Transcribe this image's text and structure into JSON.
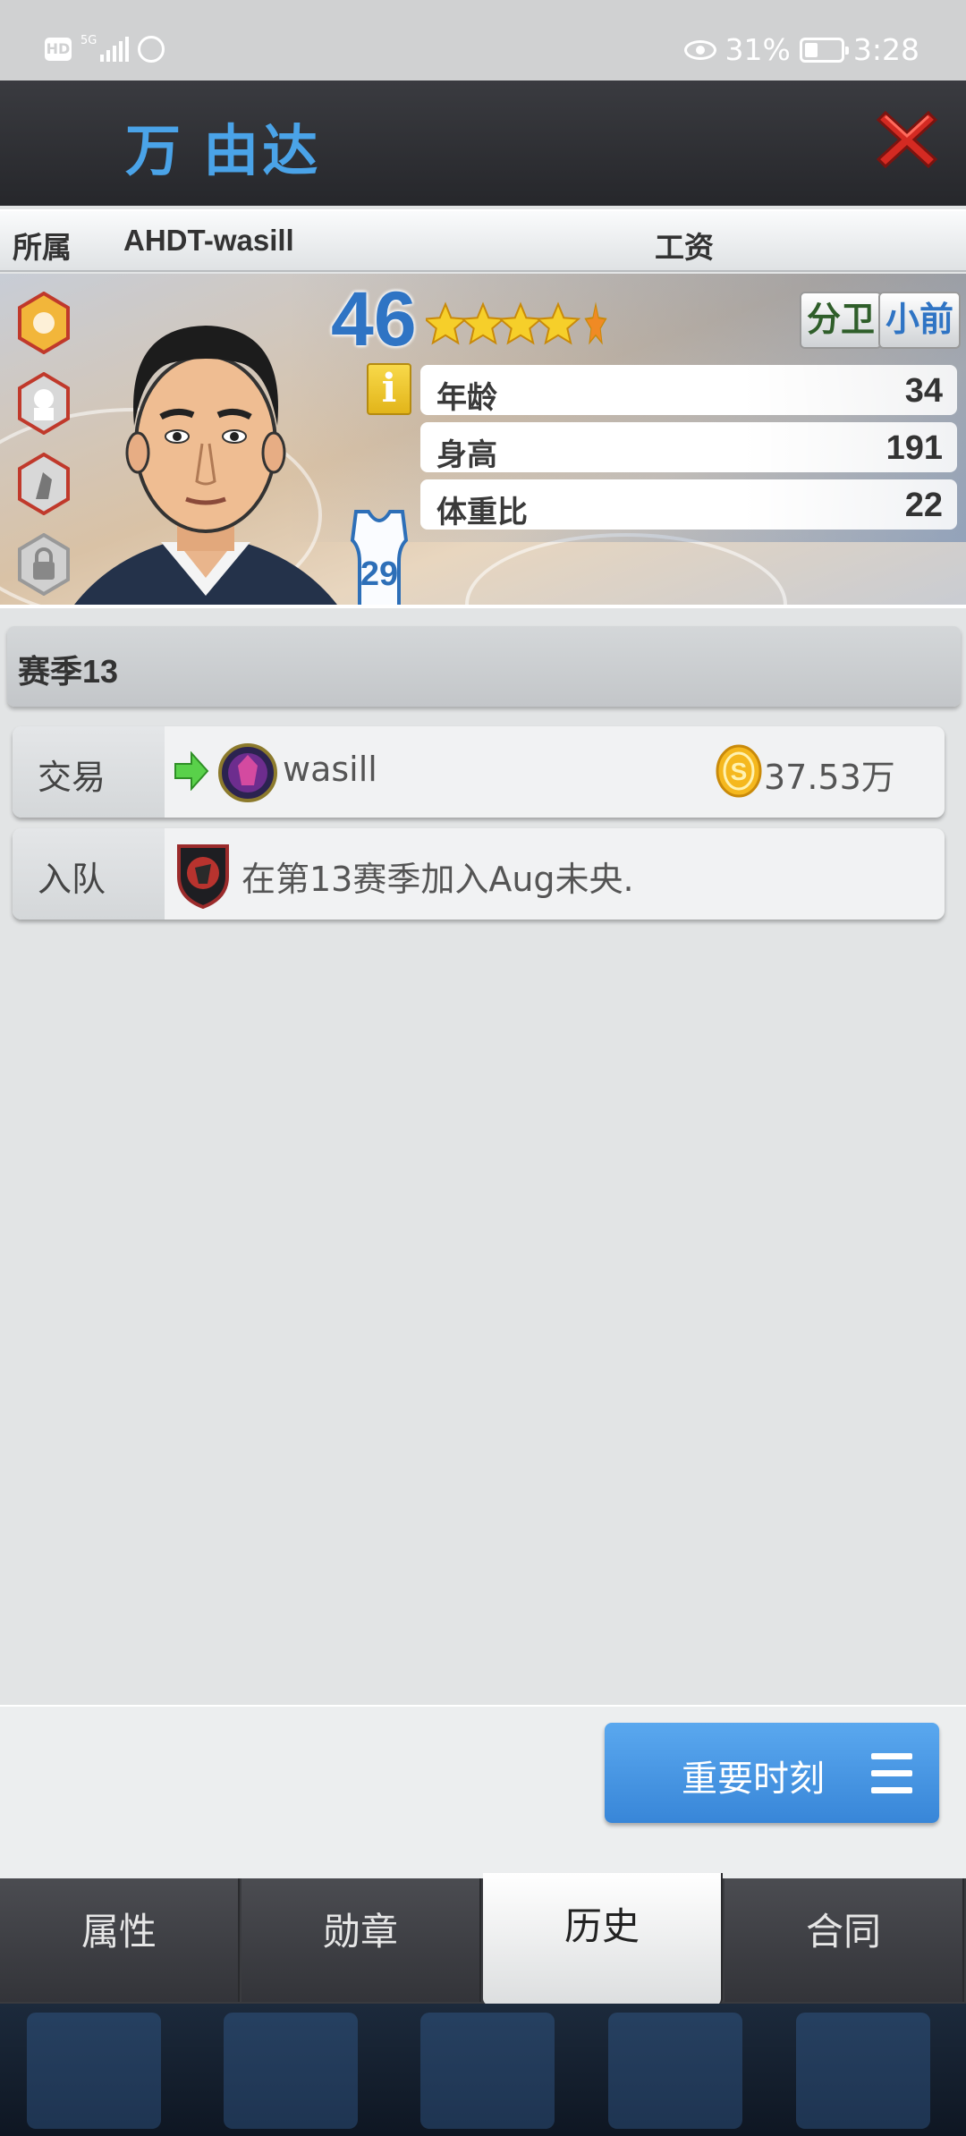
{
  "status_bar": {
    "hd": "HD",
    "network": "5G",
    "battery": "31%",
    "time": "3:28"
  },
  "header": {
    "player_name": "万 由达"
  },
  "team_row": {
    "affiliation_label": "所属",
    "team_name": "AHDT-wasill",
    "salary_label": "工资"
  },
  "player": {
    "rating": "46",
    "stars": 4.5,
    "positions": [
      "分卫",
      "小前"
    ],
    "jersey_number": "29",
    "stats": [
      {
        "label": "年龄",
        "value": "34"
      },
      {
        "label": "身高",
        "value": "191"
      },
      {
        "label": "体重比",
        "value": "22"
      }
    ]
  },
  "season": {
    "title": "赛季13"
  },
  "history": [
    {
      "type": "交易",
      "team": "wasill",
      "amount": "37.53万"
    },
    {
      "type": "入队",
      "text": "在第13赛季加入Aug未央."
    }
  ],
  "moments_button": {
    "label": "重要时刻"
  },
  "tabs": [
    {
      "label": "属性"
    },
    {
      "label": "勋章"
    },
    {
      "label": "历史",
      "active": true
    },
    {
      "label": "合同"
    }
  ],
  "colors": {
    "name_blue": "#4aa3e8",
    "rating_blue": "#2f74c4",
    "close_red": "#d42a22",
    "button_blue": "#3886d8"
  }
}
